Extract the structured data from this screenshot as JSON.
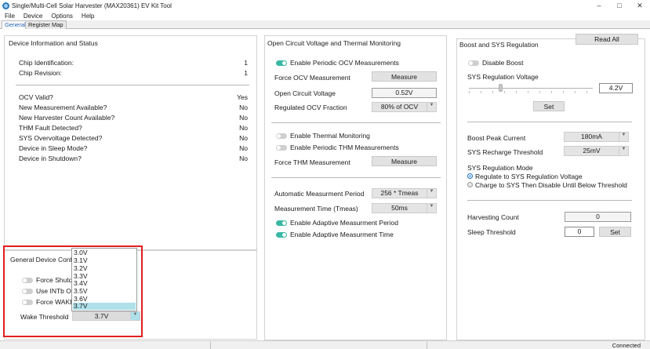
{
  "window": {
    "title": "Single/Multi-Cell Solar Harvester (MAX20361) EV Kit Tool",
    "minimize": "–",
    "maximize": "□",
    "close": "✕"
  },
  "menu": [
    "File",
    "Device",
    "Options",
    "Help"
  ],
  "tabs": [
    "General",
    "Register Map"
  ],
  "device_info": {
    "title": "Device Information and Status",
    "rows": [
      {
        "label": "Chip Identification:",
        "value": "1"
      },
      {
        "label": "Chip Revision:",
        "value": "1"
      }
    ],
    "status_rows": [
      {
        "label": "OCV Valid?",
        "value": "Yes"
      },
      {
        "label": "New  Measurement Available?",
        "value": "No"
      },
      {
        "label": "New Harvester Count Available?",
        "value": "No"
      },
      {
        "label": "THM Fault Detected?",
        "value": "No"
      },
      {
        "label": "SYS Overvoltage Detected?",
        "value": "No"
      },
      {
        "label": "Device in Sleep Mode?",
        "value": "No"
      },
      {
        "label": "Device in Shutdown?",
        "value": "No"
      }
    ]
  },
  "general_config": {
    "title": "General Device Config",
    "toggles": [
      "Force Shutdo",
      "Use INTb Out",
      "Force WAKE"
    ],
    "wake_label": "Wake Threshold",
    "wake_value": "3.7V",
    "options": [
      "3.0V",
      "3.1V",
      "3.2V",
      "3.3V",
      "3.4V",
      "3.5V",
      "3.6V",
      "3.7V"
    ],
    "selected_index": 7
  },
  "ocv": {
    "title": "Open Circuit Voltage and Thermal Monitoring",
    "enable_periodic_ocv": "Enable Periodic OCV Measurements",
    "force_ocv_label": "Force OCV Measurement",
    "measure_button": "Measure",
    "ocv_label": "Open Circuit Voltage",
    "ocv_value": "0.52V",
    "fraction_label": "Regulated OCV Fraction",
    "fraction_value": "80% of OCV",
    "enable_thermal": "Enable Thermal Monitoring",
    "enable_periodic_thm": "Enable Periodic THM Measurements",
    "force_thm_label": "Force THM Measurement",
    "measure_button_2": "Measure",
    "auto_period_label": "Automatic Measurment Period",
    "auto_period_value": "256 * Tmeas",
    "meas_time_label": "Measurement Time (Tmeas)",
    "meas_time_value": "50ms",
    "adaptive_period": "Enable Adaptive Measurment Period",
    "adaptive_time": "Enable Adaptive Measurment Time"
  },
  "boost": {
    "title": "Boost and SYS Regulation",
    "read_all": "Read All",
    "disable_boost": "Disable Boost",
    "sys_reg_label": "SYS Regulation Voltage",
    "sys_reg_value": "4.2V",
    "set_button": "Set",
    "peak_label": "Boost Peak Current",
    "peak_value": "180mA",
    "recharge_label": "SYS Recharge Threshold",
    "recharge_value": "25mV",
    "mode_label": "SYS Regulation Mode",
    "mode_options": [
      "Regulate to SYS Regulation Voltage",
      "Charge to SYS Then Disable Until Below Threshold"
    ],
    "harvest_label": "Harvesting Count",
    "harvest_value": "0",
    "sleep_label": "Sleep Threshold",
    "sleep_value": "0",
    "sleep_set": "Set"
  },
  "status": {
    "text": "Connected"
  }
}
